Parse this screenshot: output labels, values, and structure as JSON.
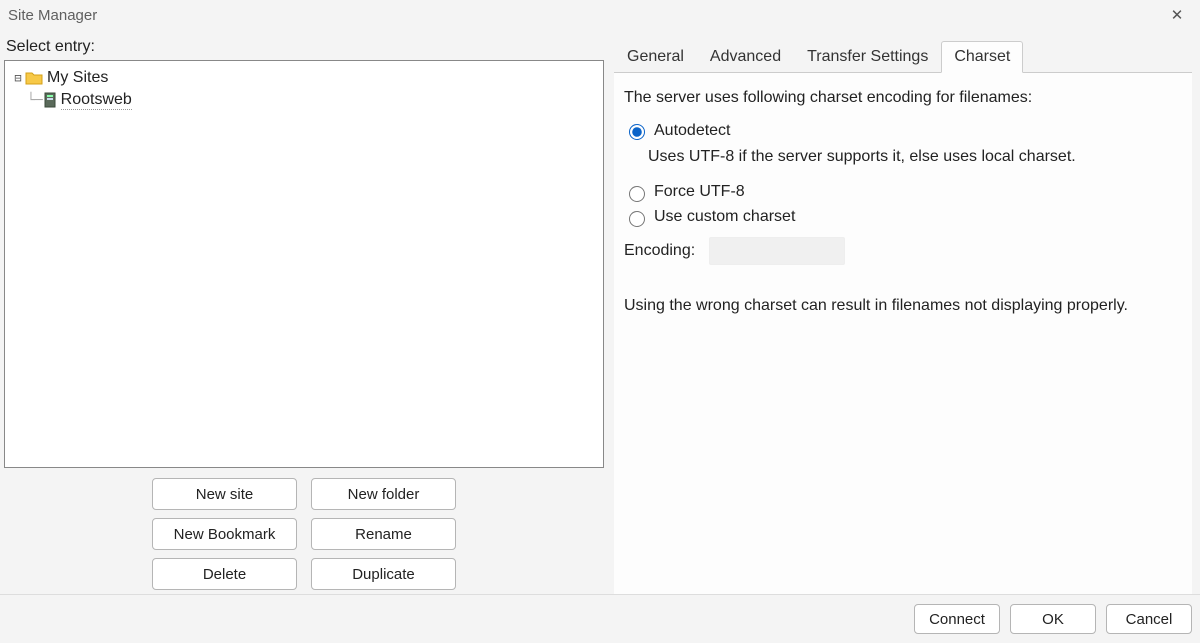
{
  "title": "Site Manager",
  "left": {
    "label": "Select entry:",
    "root_name": "My Sites",
    "site_name": "Rootsweb",
    "buttons": {
      "new_site": "New site",
      "new_folder": "New folder",
      "new_bookmark": "New Bookmark",
      "rename": "Rename",
      "delete": "Delete",
      "duplicate": "Duplicate"
    }
  },
  "tabs": {
    "general": "General",
    "advanced": "Advanced",
    "transfer": "Transfer Settings",
    "charset": "Charset"
  },
  "charset_panel": {
    "intro": "The server uses following charset encoding for filenames:",
    "opt_autodetect": "Autodetect",
    "autodetect_desc": "Uses UTF-8 if the server supports it, else uses local charset.",
    "opt_forceutf8": "Force UTF-8",
    "opt_custom": "Use custom charset",
    "encoding_label": "Encoding:",
    "warning": "Using the wrong charset can result in filenames not displaying properly."
  },
  "footer": {
    "connect": "Connect",
    "ok": "OK",
    "cancel": "Cancel"
  }
}
